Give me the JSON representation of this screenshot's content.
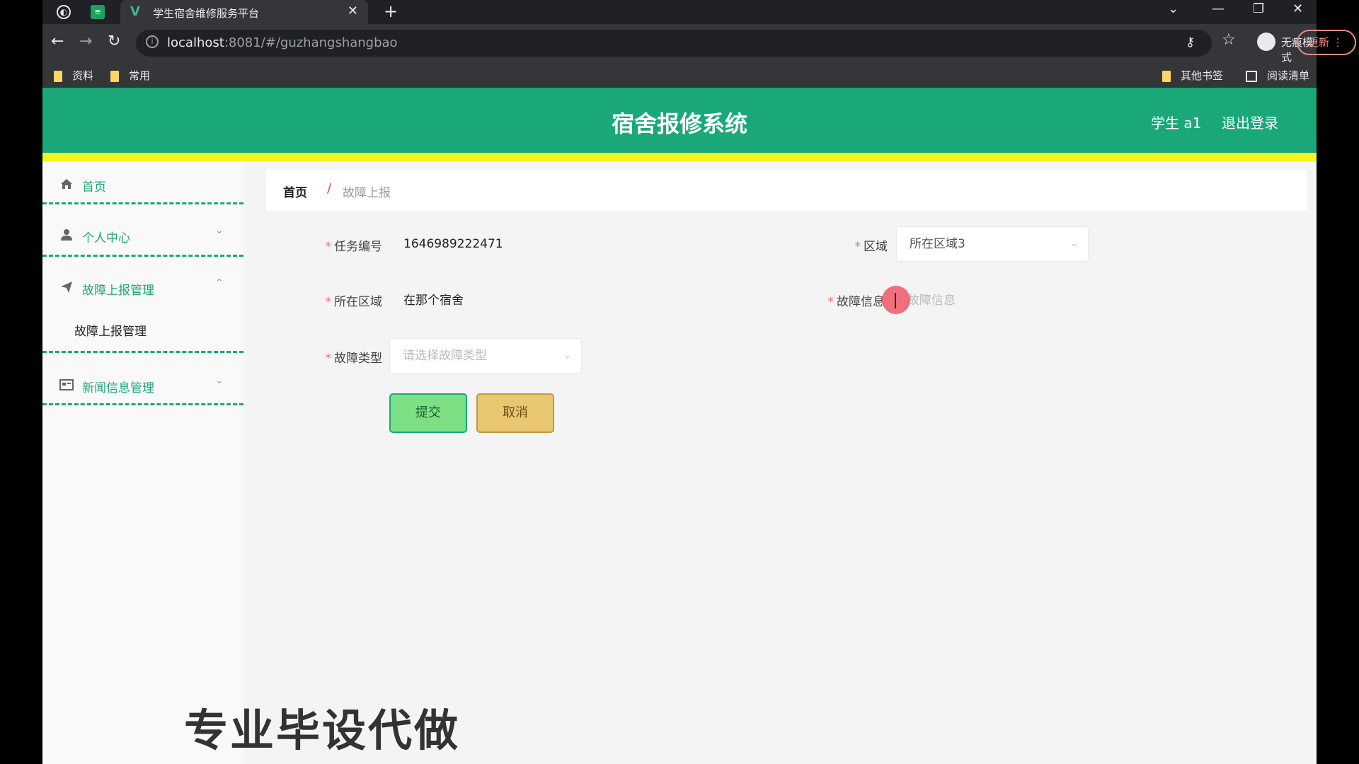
{
  "browser": {
    "tab_title": "学生宿舍维修服务平台",
    "url_host": "localhost",
    "url_rest": ":8081/#/guzhangshangbao",
    "incognito_label": "无痕模式",
    "update_label": "更新",
    "bookmarks": [
      "资料",
      "常用"
    ],
    "other_bookmarks": "其他书签",
    "reading_list": "阅读清单"
  },
  "header": {
    "title": "宿舍报修系统",
    "user": "学生 a1",
    "logout": "退出登录",
    "bg_color": "#1ba879",
    "accent_line": "#f5f222"
  },
  "sidebar": {
    "items": [
      {
        "label": "首页",
        "icon": "home-icon"
      },
      {
        "label": "个人中心",
        "icon": "user-icon"
      },
      {
        "label": "故障上报管理",
        "icon": "send-icon"
      },
      {
        "label": "新闻信息管理",
        "icon": "news-icon"
      }
    ],
    "submenu": "故障上报管理"
  },
  "breadcrumb": {
    "home": "首页",
    "sep": "/",
    "current": "故障上报"
  },
  "form": {
    "task_no_label": "任务编号",
    "task_no_value": "1646989222471",
    "area_label": "区域",
    "area_value": "所在区域3",
    "location_label": "所在区域",
    "location_value": "在那个宿舍",
    "fault_info_label": "故障信息",
    "fault_info_placeholder": "故障信息",
    "fault_type_label": "故障类型",
    "fault_type_placeholder": "请选择故障类型",
    "required_mark": "*",
    "submit": "提交",
    "cancel": "取消"
  },
  "watermark": "专业毕设代做"
}
